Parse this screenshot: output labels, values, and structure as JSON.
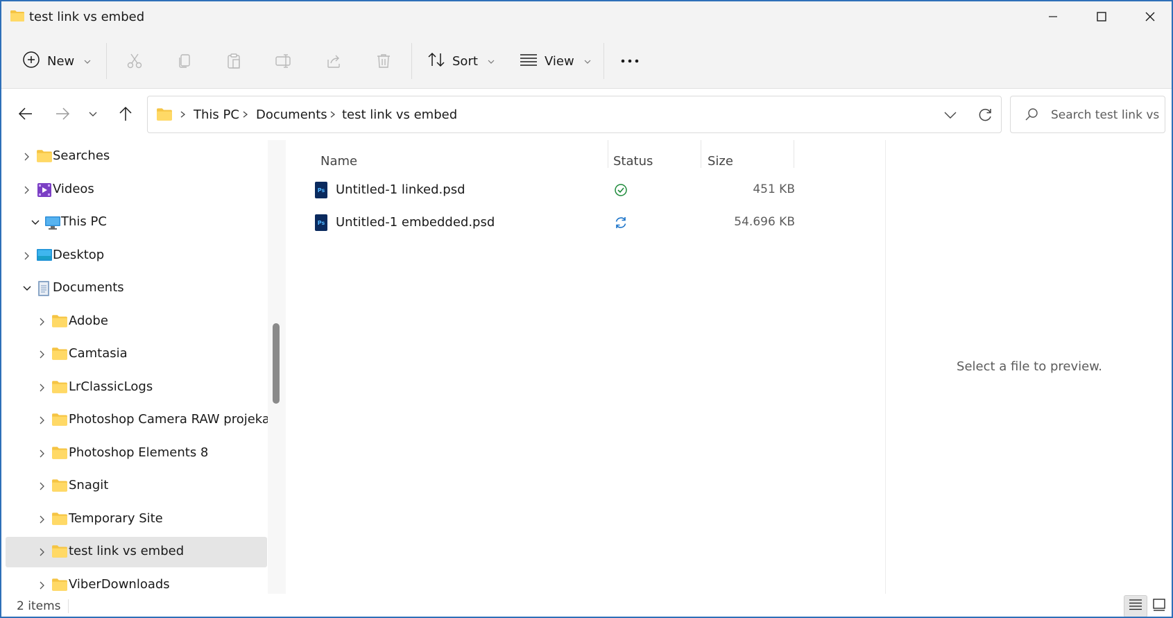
{
  "window": {
    "title": "test link vs embed"
  },
  "toolbar": {
    "new_label": "New",
    "sort_label": "Sort",
    "view_label": "View",
    "actions": [
      "cut-icon",
      "copy-icon",
      "paste-icon",
      "rename-icon",
      "share-icon",
      "delete-icon"
    ]
  },
  "address": {
    "crumbs": [
      "This PC",
      "Documents",
      "test link vs embed"
    ]
  },
  "search": {
    "placeholder": "Search test link vs ..."
  },
  "nav": {
    "items": [
      {
        "label": "Searches",
        "icon": "folder-icon",
        "level": 1,
        "expanded": false
      },
      {
        "label": "Videos",
        "icon": "videos-icon",
        "level": 1,
        "expanded": false
      },
      {
        "label": "This PC",
        "icon": "this-pc-icon",
        "level": 0,
        "expanded": true
      },
      {
        "label": "Desktop",
        "icon": "desktop-icon",
        "level": 1,
        "expanded": false
      },
      {
        "label": "Documents",
        "icon": "documents-icon",
        "level": 1,
        "expanded": true
      },
      {
        "label": "Adobe",
        "icon": "folder-icon",
        "level": 2,
        "expanded": false
      },
      {
        "label": "Camtasia",
        "icon": "folder-icon",
        "level": 2,
        "expanded": false
      },
      {
        "label": "LrClassicLogs",
        "icon": "folder-icon",
        "level": 2,
        "expanded": false
      },
      {
        "label": "Photoshop Camera RAW projekat",
        "icon": "folder-icon",
        "level": 2,
        "expanded": false
      },
      {
        "label": "Photoshop Elements 8",
        "icon": "folder-icon",
        "level": 2,
        "expanded": false
      },
      {
        "label": "Snagit",
        "icon": "folder-icon",
        "level": 2,
        "expanded": false
      },
      {
        "label": "Temporary Site",
        "icon": "folder-icon",
        "level": 2,
        "expanded": false
      },
      {
        "label": "test link vs embed",
        "icon": "folder-icon",
        "level": 2,
        "expanded": false,
        "selected": true
      },
      {
        "label": "ViberDownloads",
        "icon": "folder-icon",
        "level": 2,
        "expanded": false
      }
    ]
  },
  "columns": {
    "name": "Name",
    "status": "Status",
    "size": "Size"
  },
  "files": [
    {
      "name": "Untitled-1 linked.psd",
      "status": "synced",
      "size": "451 KB"
    },
    {
      "name": "Untitled-1 embedded.psd",
      "status": "syncing",
      "size": "54.696 KB"
    }
  ],
  "preview": {
    "message": "Select a file to preview."
  },
  "statusbar": {
    "item_count": "2 items"
  },
  "colors": {
    "window_border": "#2e6fb8",
    "folder_yellow": "#f5c443",
    "status_green": "#1d8a3a",
    "status_blue": "#1a73c9",
    "ps_blue": "#0a2a5e"
  }
}
